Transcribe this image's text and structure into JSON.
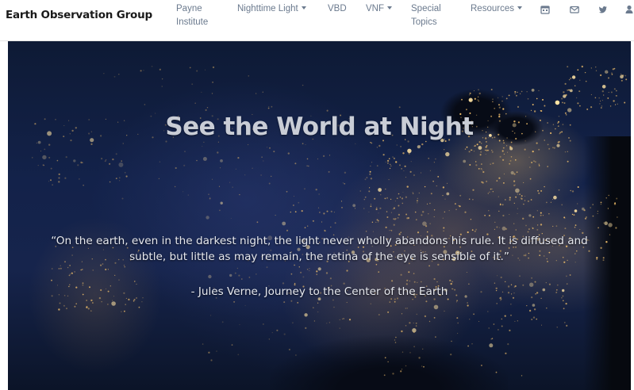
{
  "navbar": {
    "brand": "Earth Observation Group",
    "items": [
      {
        "label_line1": "Payne",
        "label_line2": "Institute",
        "dropdown": false
      },
      {
        "label": "Nighttime Light",
        "dropdown": true
      },
      {
        "label": "VBD",
        "dropdown": false
      },
      {
        "label": "VNF",
        "dropdown": true
      },
      {
        "label_line1": "Special",
        "label_line2": "Topics",
        "dropdown": false
      },
      {
        "label": "Resources",
        "dropdown": true
      }
    ],
    "icons": [
      "calendar-icon",
      "mail-icon",
      "twitter-icon",
      "user-icon"
    ],
    "link_color": "#6b7a8e"
  },
  "hero": {
    "title": "See the World at Night",
    "quote": "“On the earth, even in the darkest night, the light never wholly abandons his rule. It is diffused and subtle, but little as may remain, the retina of the eye is sensible of it.”",
    "attribution": "- Jules Verne, Journey to the Center of the Earth",
    "background_image": "night-lights-map"
  }
}
